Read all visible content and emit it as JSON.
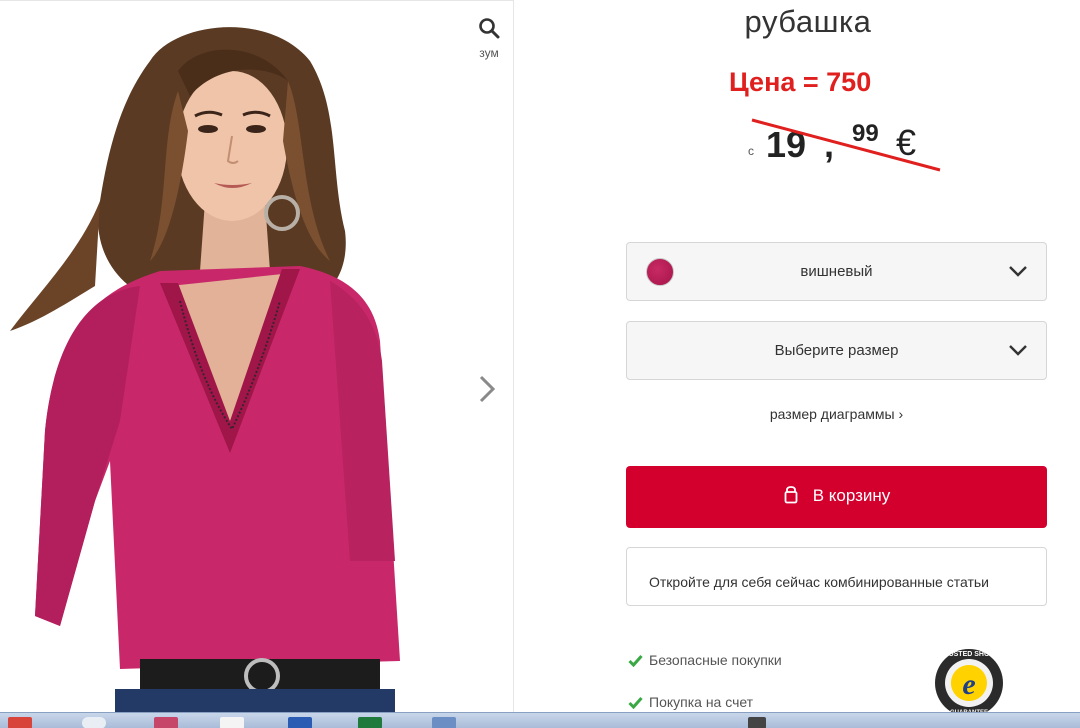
{
  "gallery": {
    "zoom_label": "зум"
  },
  "product": {
    "title": "рубашка",
    "annotation": "Цена = 750",
    "price_prefix": "с",
    "price_int": "19",
    "price_comma": ",",
    "price_cents": "99",
    "price_currency": "€"
  },
  "options": {
    "color_selected": "вишневый",
    "color_hex": "#b41b52",
    "size_placeholder": "Выберите размер",
    "size_chart_link": "размер диаграммы ›"
  },
  "cart": {
    "label": "В корзину",
    "color": "#d3002e"
  },
  "combine": {
    "label": "Откройте для себя сейчас комбинированные статьи"
  },
  "features": [
    "Безопасные покупки",
    "Покупка на счет"
  ],
  "icons": {
    "zoom": "search-icon",
    "next": "chevron-right-icon",
    "dropdown": "chevron-down-icon",
    "cart": "shopping-bag-icon",
    "check": "checkmark-icon",
    "badge": "trusted-shops-badge"
  },
  "badge": {
    "text_top": "TRUSTED SHOPS",
    "text_bottom": "GUARANTEE",
    "letter": "e"
  }
}
